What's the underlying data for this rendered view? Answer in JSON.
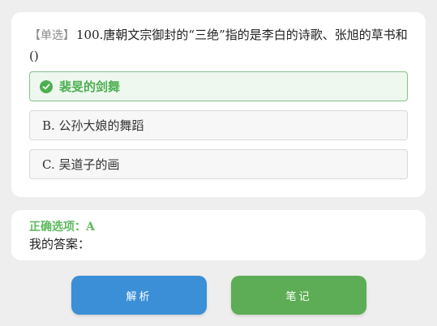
{
  "question": {
    "tag": "【单选】",
    "text": "100.唐朝文宗御封的“三绝”指的是李白的诗歌、张旭的草书和()"
  },
  "options": [
    {
      "label": "裴旻的剑舞",
      "state": "correct"
    },
    {
      "label": "B. 公孙大娘的舞蹈",
      "state": "normal"
    },
    {
      "label": "C. 吴道子的画",
      "state": "normal"
    }
  ],
  "answer": {
    "correct_label": "正确选项：A",
    "my_answer_label": "我的答案："
  },
  "buttons": {
    "analysis": "解析",
    "notes": "笔记"
  },
  "colors": {
    "correct_green": "#4caf50",
    "analysis_blue": "#3a8fd6",
    "notes_green": "#5cad55"
  }
}
